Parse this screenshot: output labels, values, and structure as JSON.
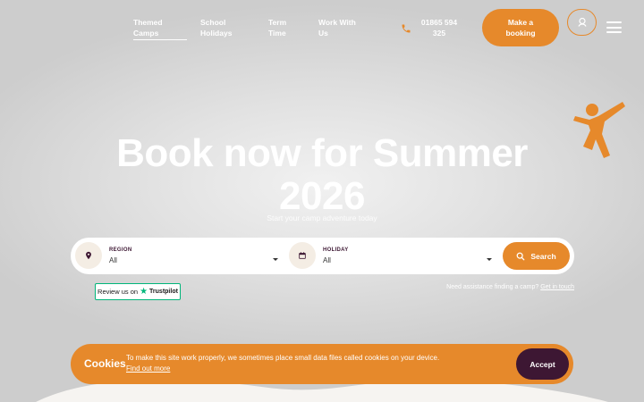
{
  "nav": {
    "links": [
      {
        "label": "Themed\nCamps",
        "active": true
      },
      {
        "label": "School\nHolidays",
        "active": false
      },
      {
        "label": "Term\nTime",
        "active": false
      },
      {
        "label": "Work With\nUs",
        "active": false
      }
    ],
    "phone": "01865 594\n325",
    "booking_label": "Make a\nbooking",
    "icons": [
      "phone-icon",
      "user-icon",
      "menu-icon"
    ]
  },
  "hero": {
    "title": "Book now for Summer 2026",
    "subtitle": "Start your camp adventure today"
  },
  "search": {
    "region": {
      "label": "REGION",
      "value": "All",
      "icon": "map-pin-icon"
    },
    "holiday": {
      "label": "HOLIDAY",
      "value": "All",
      "icon": "calendar-icon"
    },
    "button_label": "Search",
    "button_icon": "search-icon"
  },
  "trustpilot": {
    "prefix": "Review us on",
    "brand": "Trustpilot"
  },
  "assistance": {
    "text": "Need assistance finding a camp?",
    "link": "Get in touch"
  },
  "cookies": {
    "title": "Cookies",
    "text": "To make this site work properly, we sometimes place small data files called cookies on your device.",
    "link": "Find out more",
    "accept_label": "Accept"
  },
  "colors": {
    "accent": "#e6892b",
    "dark": "#3d1733",
    "trustpilot": "#00b67a"
  }
}
